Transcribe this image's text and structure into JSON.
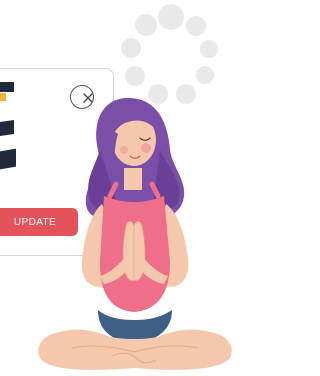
{
  "dialog": {
    "update_label": "UPDATE",
    "close_icon": "close-icon"
  },
  "illustration": {
    "subject": "woman-meditating-illustration",
    "hair_color": "#7b4ea8",
    "top_color": "#ef6f8b",
    "shorts_color": "#3f5f86",
    "skin_color": "#f5c8ad"
  },
  "loader": {
    "icon": "loading-spinner-icon",
    "dot_color": "#e9e9ea"
  },
  "colors": {
    "accent": "#e4525b"
  }
}
